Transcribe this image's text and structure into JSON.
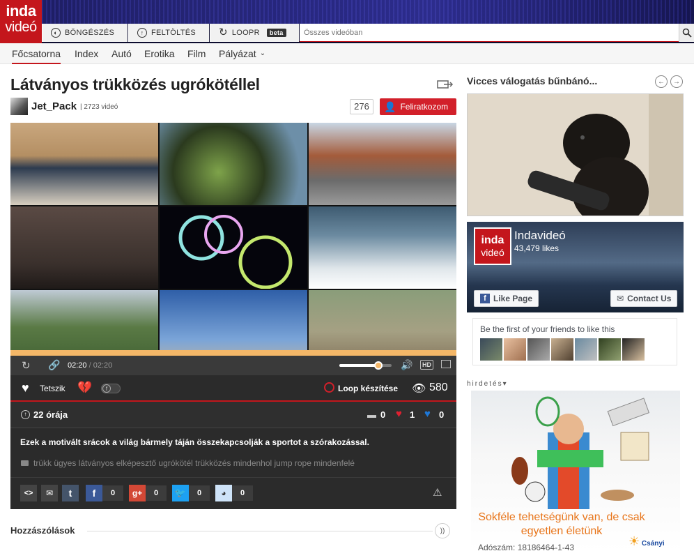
{
  "brand": {
    "logo_line1": "inda",
    "logo_line2": "videó"
  },
  "topnav": {
    "browse": "BÖNGÉSZÉS",
    "upload": "FELTÖLTÉS",
    "loopr": "LOOPR",
    "beta": "beta",
    "search_placeholder": "Összes videóban"
  },
  "subnav": [
    "Főcsatorna",
    "Index",
    "Autó",
    "Erotika",
    "Film",
    "Pályázat"
  ],
  "video": {
    "title": "Látványos trükközés ugrókötéllel",
    "uploader": "Jet_Pack",
    "video_count": "2723 videó",
    "subscriber_count": "276",
    "subscribe_label": "Feliratkozom",
    "time_current": "02:20",
    "time_separator": "/",
    "time_total": "02:20",
    "hd_label": "HD",
    "played_fraction": 1.0,
    "volume_fraction": 0.75,
    "like_label": "Tetszik",
    "loop_label": "Loop készítése",
    "views": "580",
    "uploaded_ago": "22 órája",
    "comments_count": "0",
    "hearts_count": "1",
    "broken_hearts_count": "0",
    "description": "Ezek a motivált srácok a világ bármely táján összekapcsolják a sportot a szórakozással.",
    "tags": "trükk ügyes látványos elképesztő ugrókötél trükközés mindenhol jump rope mindenfelé",
    "share_counts": {
      "facebook": "0",
      "gplus": "0",
      "twitter": "0",
      "reddit": "0"
    }
  },
  "comments_heading": "Hozzászólások",
  "sidebar": {
    "playlist_title": "Vicces válogatás bűnbánó...",
    "fb": {
      "page_name": "Indavideó",
      "likes": "43,479 likes",
      "like_page": "Like Page",
      "contact": "Contact Us",
      "friends_text": "Be the first of your friends to like this",
      "logo_line1": "inda",
      "logo_line2": "videó"
    },
    "ad_label": "hirdetés",
    "ad_text": "Sokféle tehetségünk van, de csak egyetlen életünk",
    "ad_account": "Adószám: 18186464-1-43",
    "ad_brand": "Csányi"
  },
  "colors": {
    "accent": "#c4161c",
    "progress": "#f4b768",
    "player_bg": "#2b2b2b"
  }
}
